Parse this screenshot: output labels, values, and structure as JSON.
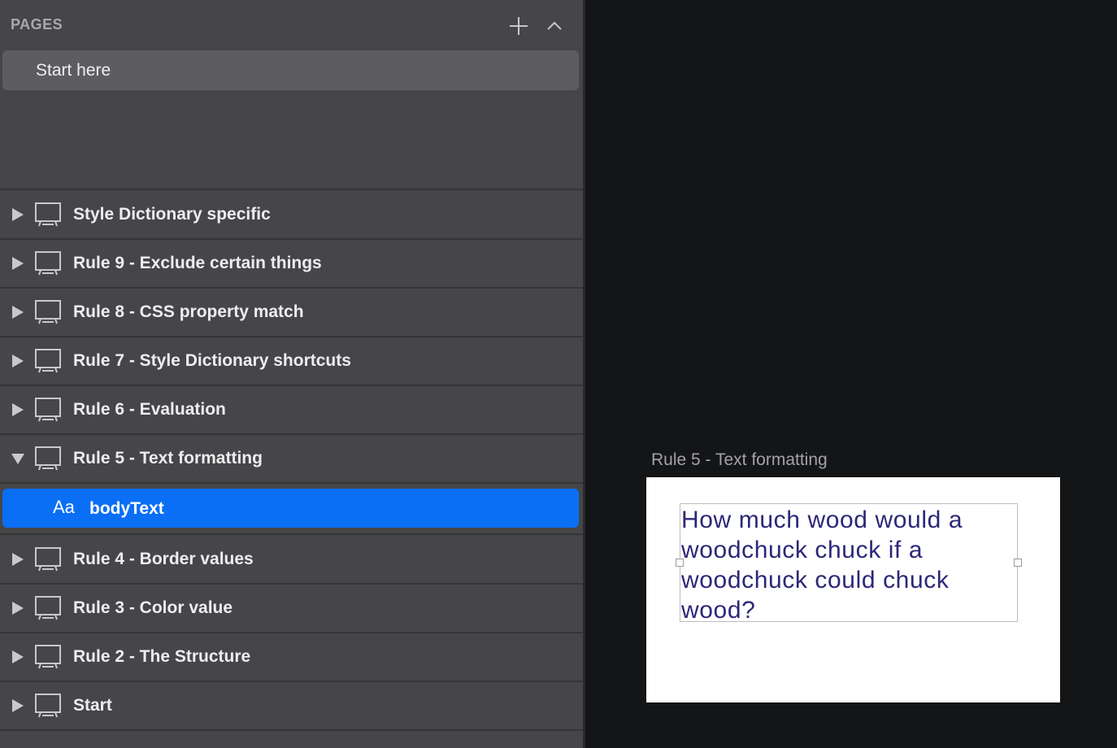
{
  "pages_panel": {
    "title": "PAGES",
    "add_icon": "plus-icon",
    "collapse_icon": "chevron-up-icon",
    "pages": [
      {
        "label": "Start here",
        "selected": true
      }
    ]
  },
  "layers": [
    {
      "label": "Style Dictionary specific",
      "expanded": false
    },
    {
      "label": "Rule 9 - Exclude certain things",
      "expanded": false
    },
    {
      "label": "Rule 8 - CSS property match",
      "expanded": false
    },
    {
      "label": "Rule 7 - Style Dictionary shortcuts",
      "expanded": false
    },
    {
      "label": "Rule 6 - Evaluation",
      "expanded": false
    },
    {
      "label": "Rule 5 - Text formatting",
      "expanded": true,
      "children": [
        {
          "label": "bodyText",
          "icon": "text-layer-icon",
          "icon_text": "Aa",
          "selected": true
        }
      ]
    },
    {
      "label": "Rule 4 - Border values",
      "expanded": false
    },
    {
      "label": "Rule 3 - Color value",
      "expanded": false
    },
    {
      "label": "Rule 2 - The Structure",
      "expanded": false
    },
    {
      "label": "Start",
      "expanded": false
    }
  ],
  "canvas": {
    "artboard_title": "Rule 5 - Text formatting",
    "text_content": "How much wood would a woodchuck chuck if a woodchuck could chuck wood?",
    "text_color": "#2c2778"
  },
  "colors": {
    "selection": "#0a6ff5",
    "sidebar": "#464649",
    "canvas": "#141517"
  }
}
